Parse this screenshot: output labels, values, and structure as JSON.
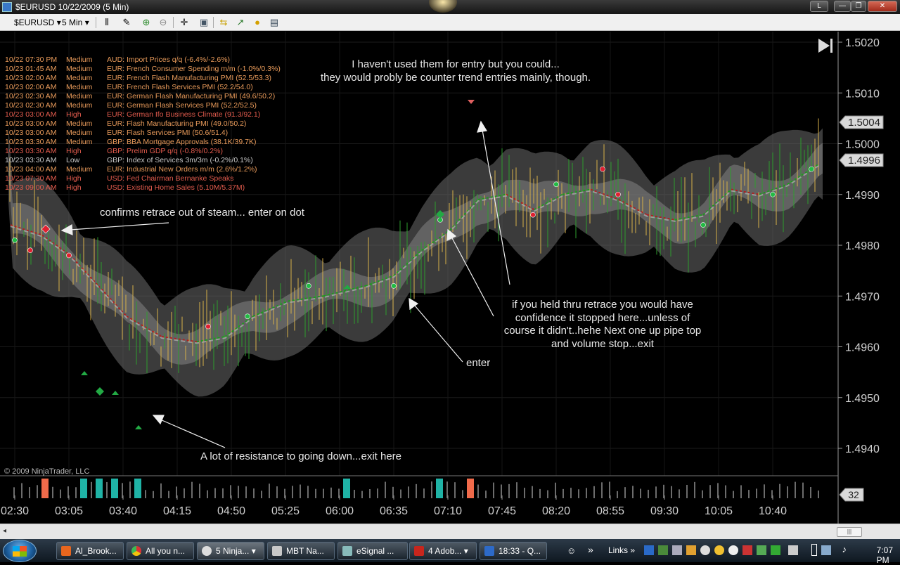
{
  "window": {
    "title": "$EURUSD  10/22/2009 (5 Min)",
    "controls": [
      "L",
      "—",
      "❐",
      "✕"
    ]
  },
  "toolbar": {
    "instrument": "$EURUSD",
    "interval": "5 Min"
  },
  "chart": {
    "price_labels": [
      "1.5020",
      "1.5010",
      "1.5000",
      "1.4990",
      "1.4980",
      "1.4970",
      "1.4960",
      "1.4950",
      "1.4940"
    ],
    "price_values": [
      1.502,
      1.501,
      1.5,
      1.499,
      1.498,
      1.497,
      1.496,
      1.495,
      1.494
    ],
    "current_price_boxes": [
      "1.5004",
      "1.4996"
    ],
    "volume_box": "32",
    "time_labels": [
      "02:30",
      "03:05",
      "03:40",
      "04:15",
      "04:50",
      "05:25",
      "06:00",
      "06:35",
      "07:10",
      "07:45",
      "08:20",
      "08:55",
      "09:30",
      "10:05",
      "10:40"
    ],
    "copyright": "© 2009 NinjaTrader, LLC",
    "news": [
      {
        "date": "10/22 07:30 PM",
        "impact": "Medium",
        "text": "AUD: Import Prices q/q (-6.4%/-2.6%)"
      },
      {
        "date": "10/23 01:45 AM",
        "impact": "Medium",
        "text": "EUR: French Consumer Spending m/m (-1.0%/0.3%)"
      },
      {
        "date": "10/23 02:00 AM",
        "impact": "Medium",
        "text": "EUR: French Flash Manufacturing PMI (52.5/53.3)"
      },
      {
        "date": "10/23 02:00 AM",
        "impact": "Medium",
        "text": "EUR: French Flash Services PMI (52.2/54.0)"
      },
      {
        "date": "10/23 02:30 AM",
        "impact": "Medium",
        "text": "EUR: German Flash Manufacturing PMI (49.6/50.2)"
      },
      {
        "date": "10/23 02:30 AM",
        "impact": "Medium",
        "text": "EUR: German Flash Services PMI (52.2/52.5)"
      },
      {
        "date": "10/23 03:00 AM",
        "impact": "High",
        "text": "EUR: German Ifo Business Climate (91.3/92.1)"
      },
      {
        "date": "10/23 03:00 AM",
        "impact": "Medium",
        "text": "EUR: Flash Manufacturing PMI (49.0/50.2)"
      },
      {
        "date": "10/23 03:00 AM",
        "impact": "Medium",
        "text": "EUR: Flash Services PMI (50.6/51.4)"
      },
      {
        "date": "10/23 03:30 AM",
        "impact": "Medium",
        "text": "GBP: BBA Mortgage Approvals (38.1K/39.7K)"
      },
      {
        "date": "10/23 03:30 AM",
        "impact": "High",
        "text": "GBP: Prelim GDP q/q (-0.8%/0.2%)"
      },
      {
        "date": "10/23 03:30 AM",
        "impact": "Low",
        "text": "GBP: Index of Services 3m/3m (-0.2%/0.1%)"
      },
      {
        "date": "10/23 04:00 AM",
        "impact": "Medium",
        "text": "EUR: Industrial New Orders m/m (2.6%/1.2%)"
      },
      {
        "date": "10/23 07:30 AM",
        "impact": "High",
        "text": "USD: Fed Chairman Bernanke Speaks"
      },
      {
        "date": "10/23 09:00 AM",
        "impact": "High",
        "text": "USD: Existing Home Sales (5.10M/5.37M)"
      }
    ],
    "annotations": {
      "top_line1": "I haven't used them for entry but you could...",
      "top_line2": "they would probly be counter trend entries mainly, though.",
      "confirms": "confirms retrace out of steam... enter on dot",
      "hold_line1": "if you held thru retrace you would have",
      "hold_line2": "confidence it stopped here...unless of",
      "hold_line3": "course it didn't..hehe Next one up pipe top",
      "hold_line4": "and volume stop...exit",
      "enter": "enter",
      "resistance": "A lot of resistance to going down...exit here"
    },
    "colors": {
      "up_bar": "#2e9e2e",
      "down_bar": "#d7b04a",
      "band": "#6b6b6b",
      "ma_up": "#1e9a1e",
      "ma_down": "#b02020",
      "volume_highlight_up": "#1fb3a6",
      "volume_highlight_down": "#f06a4a",
      "news_medium": "#e89a5a",
      "news_high": "#e25b4d",
      "news_low": "#c8c8c8"
    }
  },
  "taskbar": {
    "tasks": [
      "Al_Brook...",
      "All you n...",
      "5 Ninja...",
      "MBT Na...",
      "eSignal ...",
      "4 Adob...",
      "18:33 - Q..."
    ],
    "links": "Links",
    "clock": "7:07 PM"
  }
}
